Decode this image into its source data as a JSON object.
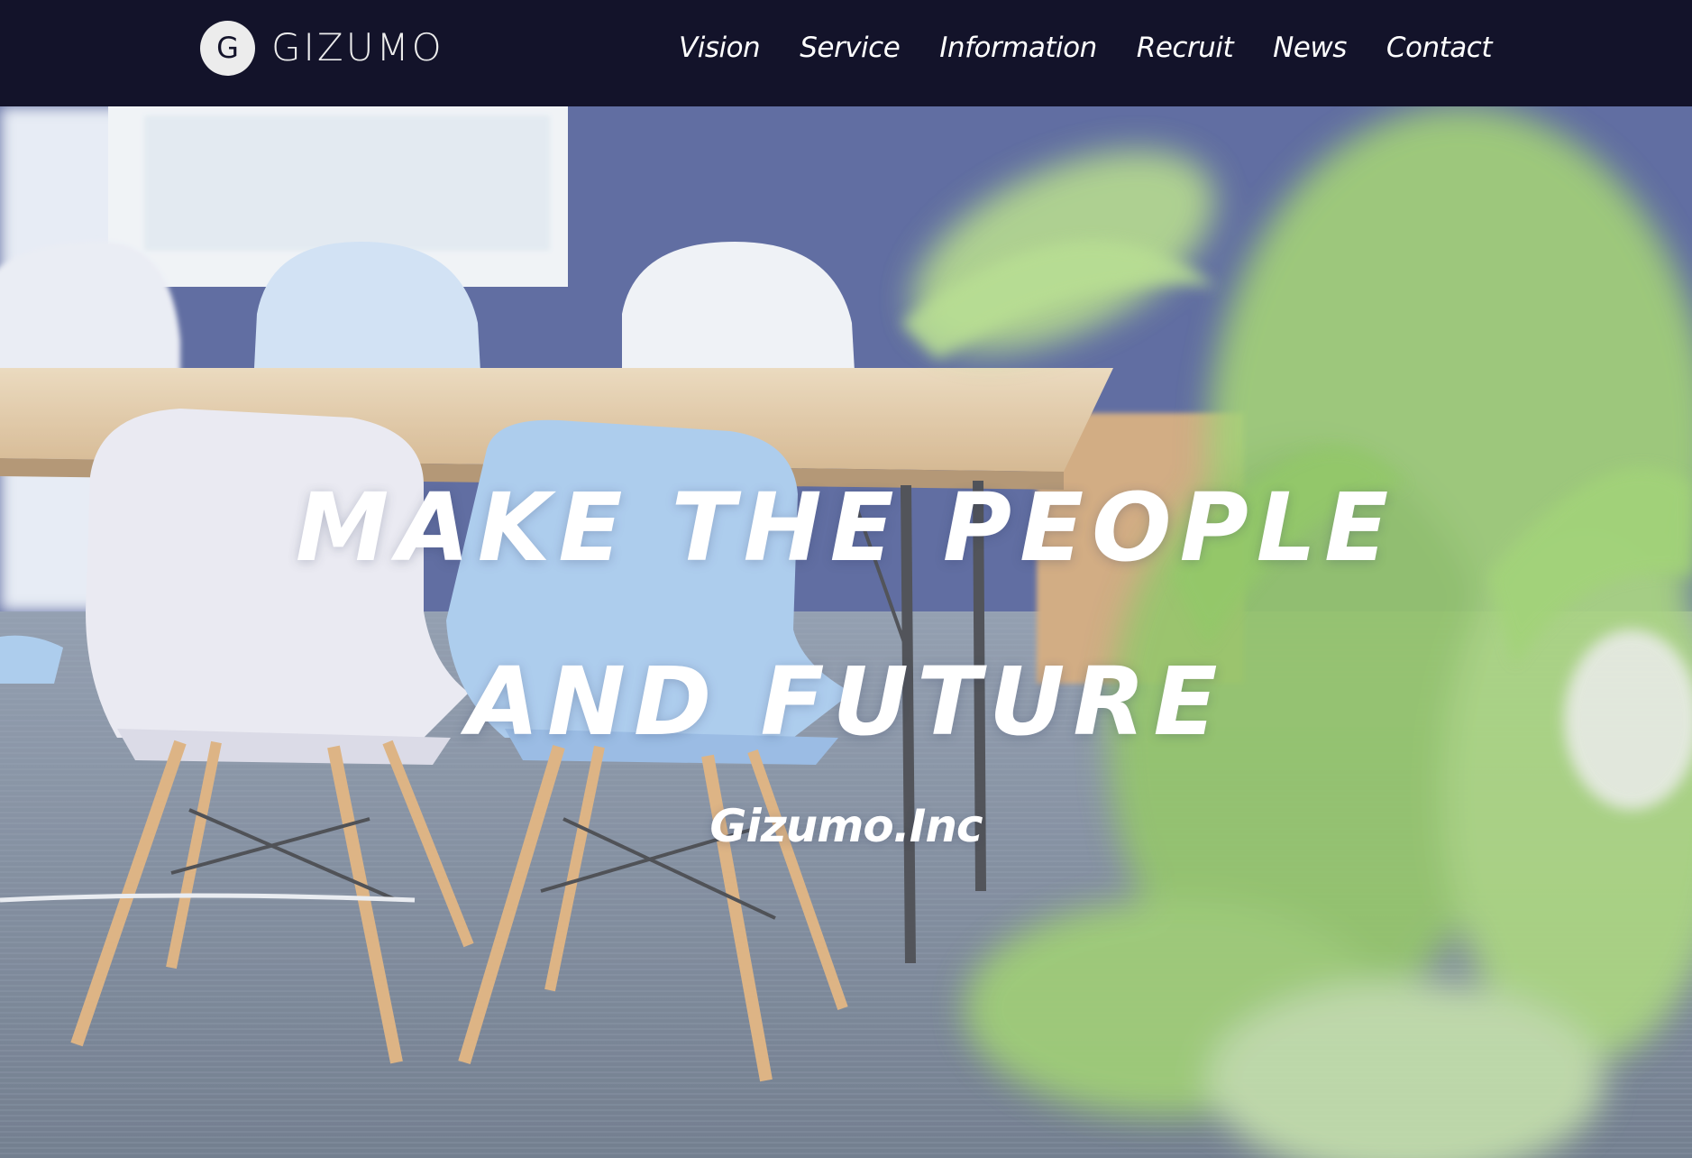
{
  "header": {
    "logo_mark": "G",
    "logo_text": "GIZUMO",
    "nav": [
      {
        "label": "Vision"
      },
      {
        "label": "Service"
      },
      {
        "label": "Information"
      },
      {
        "label": "Recruit"
      },
      {
        "label": "News"
      },
      {
        "label": "Contact"
      }
    ]
  },
  "hero": {
    "headline_line1": "MAKE THE PEOPLE",
    "headline_line2": "AND FUTURE",
    "company": "Gizumo.Inc"
  },
  "colors": {
    "header_bg": "#13132a",
    "text": "#ffffff",
    "wall": "#3e4f8c",
    "floor": "#6a7a90",
    "plant": "#8cc45a"
  }
}
